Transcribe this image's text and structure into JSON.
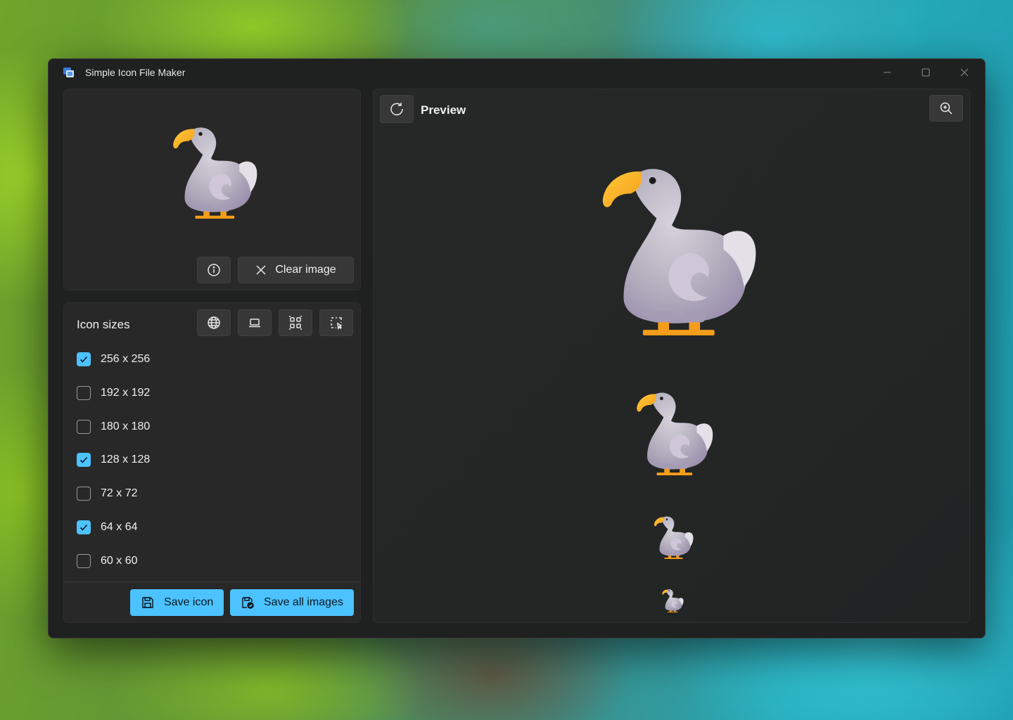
{
  "window": {
    "title": "Simple Icon File Maker"
  },
  "image_panel": {
    "clear_label": "Clear image"
  },
  "sizes": {
    "heading": "Icon sizes",
    "items": [
      {
        "label": "256 x 256",
        "checked": true
      },
      {
        "label": "192 x 192",
        "checked": false
      },
      {
        "label": "180 x 180",
        "checked": false
      },
      {
        "label": "128 x 128",
        "checked": true
      },
      {
        "label": "72 x 72",
        "checked": false
      },
      {
        "label": "64 x 64",
        "checked": true
      },
      {
        "label": "60 x 60",
        "checked": false
      }
    ]
  },
  "actions": {
    "save_icon": "Save icon",
    "save_all": "Save all images"
  },
  "preview": {
    "title": "Preview"
  },
  "colors": {
    "accent": "#4cc2ff",
    "window_bg": "#1f2020",
    "panel_bg": "#272827"
  }
}
